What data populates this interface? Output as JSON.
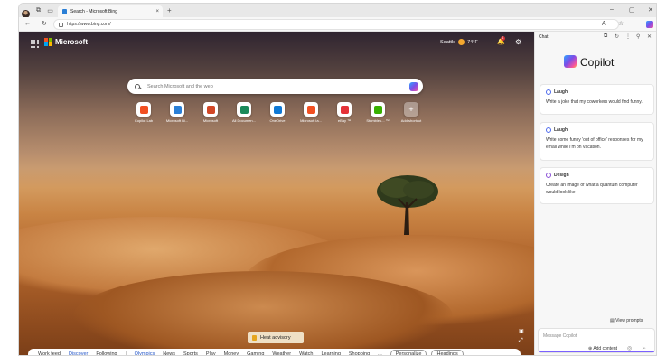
{
  "browser": {
    "tab_title": "Search - Microsoft Bing",
    "url": "https://www.bing.com/",
    "new_tab": "+",
    "close_tab": "×"
  },
  "header": {
    "brand": "Microsoft",
    "weather_city": "Seattle",
    "weather_temp": "74°F",
    "notifications_count": "1"
  },
  "search": {
    "placeholder": "Search Microsoft and the web"
  },
  "tiles": [
    {
      "label": "Copilot Lab",
      "color": "#f25022"
    },
    {
      "label": "Microsoft Bi...",
      "color": "#2a7fd6"
    },
    {
      "label": "Microsoft",
      "color": "#d24726"
    },
    {
      "label": "All Documen...",
      "color": "#1b8a5a"
    },
    {
      "label": "OneDrive",
      "color": "#0f78d4"
    },
    {
      "label": "Microsoft la...",
      "color": "#f25022"
    },
    {
      "label": "eBay ™",
      "color": "#e53238"
    },
    {
      "label": "Stumbleu... ™",
      "color": "#38b000"
    },
    {
      "label": "Add shortcut",
      "color": "#ffffff"
    }
  ],
  "heat_advisory": "Heat advisory",
  "feed_nav": {
    "items": [
      "Work feed",
      "Discover",
      "Following",
      "Olympics",
      "News",
      "Sports",
      "Play",
      "Money",
      "Gaming",
      "Weather",
      "Watch",
      "Learning",
      "Shopping",
      "..."
    ],
    "personalize": "Personalize",
    "headings": "Headings"
  },
  "sidepane": {
    "title": "Chat",
    "brand": "Copilot",
    "cards": [
      {
        "tag": "Laugh",
        "text": "Write a joke that my coworkers would find funny."
      },
      {
        "tag": "Laugh",
        "text": "Write some funny 'out of office' responses for my email while I'm on vacation."
      },
      {
        "tag": "Design",
        "text": "Create an image of what a quantum computer would look like"
      }
    ],
    "view_prompts": "View prompts",
    "message_placeholder": "Message Copilot",
    "add_content": "Add content"
  }
}
